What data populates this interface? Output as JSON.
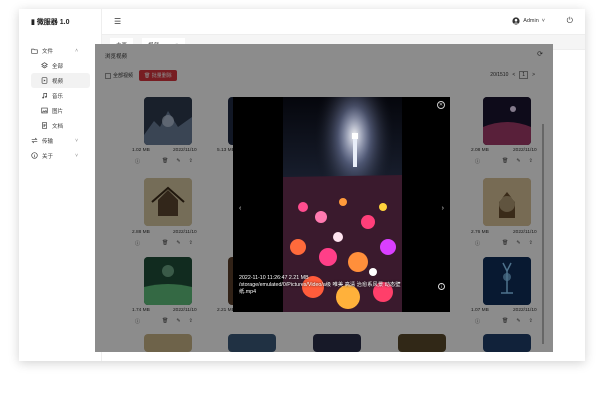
{
  "app": {
    "title": "微服器 1.0"
  },
  "sidebar": {
    "items": [
      {
        "label": "文件",
        "icon": "folder-icon",
        "chevron": "˄"
      },
      {
        "label": "全部",
        "icon": "layers-icon",
        "sub": true
      },
      {
        "label": "视频",
        "icon": "video-icon",
        "sub": true,
        "active": true
      },
      {
        "label": "音乐",
        "icon": "music-icon",
        "sub": true
      },
      {
        "label": "图片",
        "icon": "image-icon",
        "sub": true
      },
      {
        "label": "文档",
        "icon": "doc-icon",
        "sub": true
      },
      {
        "label": "传输",
        "icon": "transfer-icon",
        "chevron": "˅"
      },
      {
        "label": "关于",
        "icon": "info-icon",
        "chevron": "˅"
      }
    ]
  },
  "header": {
    "user_label": "Admin",
    "user_chevron": "˅"
  },
  "tabs": [
    {
      "label": "主页"
    },
    {
      "label": "视频",
      "active": true,
      "close": "⊗"
    }
  ],
  "main": {
    "card_title": "浏览视频",
    "select_all": "全部视频",
    "delete_label": "批量删除",
    "pager_text": "20/1510",
    "pager_prev": "<",
    "pager_current": "1",
    "pager_next": ">"
  },
  "grid": {
    "row1": [
      {
        "size": "1.02 MB",
        "date": "2022/11/10",
        "color": "#2e3b4f"
      },
      {
        "size": "5.13 MB",
        "date": "",
        "color": "#1f2a44"
      },
      {
        "size": "",
        "date": "",
        "color": "#000"
      },
      {
        "size": "",
        "date": "",
        "color": "#000"
      },
      {
        "size": "2.08 MB",
        "date": "2022/11/10",
        "color": "#2a1b3b"
      }
    ],
    "row2": [
      {
        "size": "2.88 MB",
        "date": "2022/11/10",
        "color": "#c9b488"
      },
      {
        "size": "2.76 MB",
        "date": "2022/11/10",
        "color": "#c7a678"
      }
    ],
    "row3": [
      {
        "size": "1.74 MB",
        "date": "2022/11/10",
        "color": "#2d6b4f"
      },
      {
        "size": "2.21 MB",
        "date": "2022/11/10",
        "color": "#5a3f2a"
      },
      {
        "size": "1.07 MB",
        "date": "2022/11/10",
        "color": "#123b6b"
      }
    ]
  },
  "modal": {
    "caption_line1": "2022-11-10 11:26:47   2.21 MB",
    "caption_line2": "/storage/emulated/0/Pictures/Video/a级 唯美 高清 治愈系风景 动态壁纸.mp4",
    "close": "✕",
    "prev": "‹",
    "next": "›",
    "info": "i"
  }
}
